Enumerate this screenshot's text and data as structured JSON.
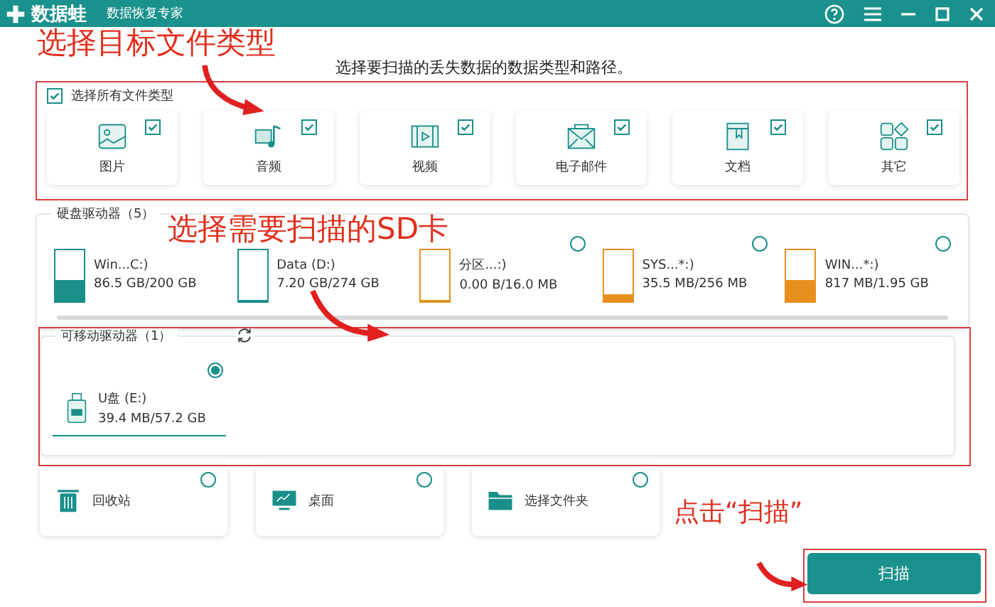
{
  "window": {
    "app_name": "数据蛙",
    "subtitle": "数据恢复专家"
  },
  "instruction": "选择要扫描的丢失数据的数据类型和路径。",
  "select_all": {
    "label": "选择所有文件类型",
    "checked": true
  },
  "file_types": [
    {
      "label": "图片",
      "checked": true
    },
    {
      "label": "音频",
      "checked": true
    },
    {
      "label": "视频",
      "checked": true
    },
    {
      "label": "电子邮件",
      "checked": true
    },
    {
      "label": "文档",
      "checked": true
    },
    {
      "label": "其它",
      "checked": true
    }
  ],
  "hard_drives": {
    "title": "硬盘驱动器（5）",
    "drives": [
      {
        "name": "Win...C:)",
        "usage": "86.5 GB/200 GB",
        "level": 0.43,
        "color": "#1a8f8a"
      },
      {
        "name": "Data (D:)",
        "usage": "7.20 GB/274 GB",
        "level": 0.03,
        "color": "#1a8f8a"
      },
      {
        "name": "分区...:)",
        "usage": "0.00  B/16.0 MB",
        "level": 0,
        "color": "#e8901e",
        "selected": false
      },
      {
        "name": "SYS...*:)",
        "usage": "35.5 MB/256 MB",
        "level": 0.14,
        "color": "#e8901e",
        "selected": false
      },
      {
        "name": "WIN...*:)",
        "usage": "817 MB/1.95 GB",
        "level": 0.42,
        "color": "#e8901e",
        "selected": false
      }
    ]
  },
  "removable_drives": {
    "title": "可移动驱动器（1）",
    "drives": [
      {
        "name": "U盘 (E:)",
        "usage": "39.4 MB/57.2 GB",
        "selected": true
      }
    ]
  },
  "locations": [
    {
      "label": "回收站",
      "selected": false
    },
    {
      "label": "桌面",
      "selected": false
    },
    {
      "label": "选择文件夹",
      "selected": false
    }
  ],
  "scan_button": "扫描",
  "annotations": [
    "选择目标文件类型",
    "选择需要扫描的SD卡",
    "点击“扫描”"
  ]
}
